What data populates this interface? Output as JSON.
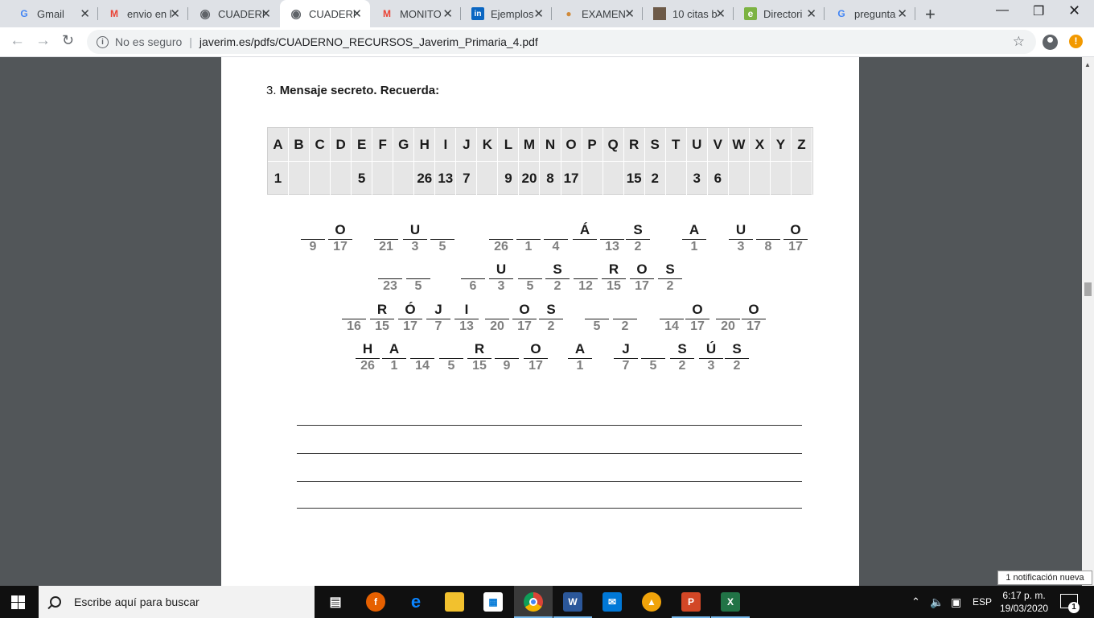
{
  "browser": {
    "tabs": [
      {
        "title": "Gmail",
        "icon": "G",
        "icon_color": "#4285f4"
      },
      {
        "title": "envio en l",
        "icon": "M",
        "icon_color": "#ea4335"
      },
      {
        "title": "CUADERN",
        "icon": "globe",
        "icon_color": "#5f6368"
      },
      {
        "title": "CUADERN",
        "icon": "globe",
        "icon_color": "#5f6368",
        "active": true
      },
      {
        "title": "MONITO",
        "icon": "M",
        "icon_color": "#ea4335"
      },
      {
        "title": "Ejemplos",
        "icon": "in",
        "icon_color": "#0a66c2"
      },
      {
        "title": "EXAMEN",
        "icon": "palette",
        "icon_color": "#d08a3a"
      },
      {
        "title": "10 citas b",
        "icon": "img",
        "icon_color": "#6d5a48"
      },
      {
        "title": "Directori",
        "icon": "e",
        "icon_color": "#7cb342"
      },
      {
        "title": "pregunta",
        "icon": "G",
        "icon_color": "#4285f4"
      }
    ],
    "new_tab": "+",
    "security": "No es seguro",
    "url": "javerim.es/pdfs/CUADERNO_RECURSOS_Javerim_Primaria_4.pdf"
  },
  "pdf": {
    "exercise_number": "3.",
    "exercise_title": "Mensaje secreto. Recuerda:",
    "cipher_letters": [
      "A",
      "B",
      "C",
      "D",
      "E",
      "F",
      "G",
      "H",
      "I",
      "J",
      "K",
      "L",
      "M",
      "N",
      "O",
      "P",
      "Q",
      "R",
      "S",
      "T",
      "U",
      "V",
      "W",
      "X",
      "Y",
      "Z"
    ],
    "cipher_numbers": [
      "1",
      "",
      "",
      "",
      "5",
      "",
      "",
      "26",
      "13",
      "7",
      "",
      "9",
      "20",
      "8",
      "17",
      "",
      "",
      "15",
      "2",
      "",
      "3",
      "6",
      "",
      "",
      "",
      ""
    ],
    "puzzle": [
      {
        "letter": "",
        "number": "9"
      },
      {
        "letter": "O",
        "number": "17"
      },
      {
        "letter": "",
        "number": "21"
      },
      {
        "letter": "U",
        "number": "3"
      },
      {
        "letter": "",
        "number": "5"
      },
      {
        "letter": "",
        "number": "26"
      },
      {
        "letter": "",
        "number": "1"
      },
      {
        "letter": "",
        "number": "4"
      },
      {
        "letter": "Á",
        "number": ""
      },
      {
        "letter": "",
        "number": "13"
      },
      {
        "letter": "S",
        "number": "2"
      },
      {
        "letter": "A",
        "number": "1"
      },
      {
        "letter": "U",
        "number": "3"
      },
      {
        "letter": "",
        "number": "8"
      },
      {
        "letter": "O",
        "number": "17"
      },
      {
        "letter": "",
        "number": "23"
      },
      {
        "letter": "",
        "number": "5"
      },
      {
        "letter": "",
        "number": "6"
      },
      {
        "letter": "U",
        "number": "3"
      },
      {
        "letter": "",
        "number": "5"
      },
      {
        "letter": "S",
        "number": "2"
      },
      {
        "letter": "",
        "number": "12"
      },
      {
        "letter": "R",
        "number": "15"
      },
      {
        "letter": "O",
        "number": "17"
      },
      {
        "letter": "S",
        "number": "2"
      },
      {
        "letter": "",
        "number": "16"
      },
      {
        "letter": "R",
        "number": "15"
      },
      {
        "letter": "Ó",
        "number": "17"
      },
      {
        "letter": "J",
        "number": "7"
      },
      {
        "letter": "I",
        "number": "13"
      },
      {
        "letter": "",
        "number": "20"
      },
      {
        "letter": "O",
        "number": "17"
      },
      {
        "letter": "S",
        "number": "2"
      },
      {
        "letter": "",
        "number": "5"
      },
      {
        "letter": "",
        "number": "2"
      },
      {
        "letter": "",
        "number": "14"
      },
      {
        "letter": "O",
        "number": "17"
      },
      {
        "letter": "",
        "number": "20"
      },
      {
        "letter": "O",
        "number": "17"
      },
      {
        "letter": "H",
        "number": "26"
      },
      {
        "letter": "A",
        "number": "1"
      },
      {
        "letter": "",
        "number": "14"
      },
      {
        "letter": "",
        "number": "5"
      },
      {
        "letter": "R",
        "number": "15"
      },
      {
        "letter": "",
        "number": "9"
      },
      {
        "letter": "O",
        "number": "17"
      },
      {
        "letter": "A",
        "number": "1"
      },
      {
        "letter": "J",
        "number": "7"
      },
      {
        "letter": "",
        "number": "5"
      },
      {
        "letter": "S",
        "number": "2"
      },
      {
        "letter": "Ú",
        "number": "3"
      },
      {
        "letter": "S",
        "number": "2"
      }
    ]
  },
  "taskbar": {
    "search_placeholder": "Escribe aquí para buscar",
    "language": "ESP",
    "time": "6:17 p. m.",
    "date": "19/03/2020",
    "notification_toast": "1 notificación nueva",
    "notification_count": "1"
  }
}
